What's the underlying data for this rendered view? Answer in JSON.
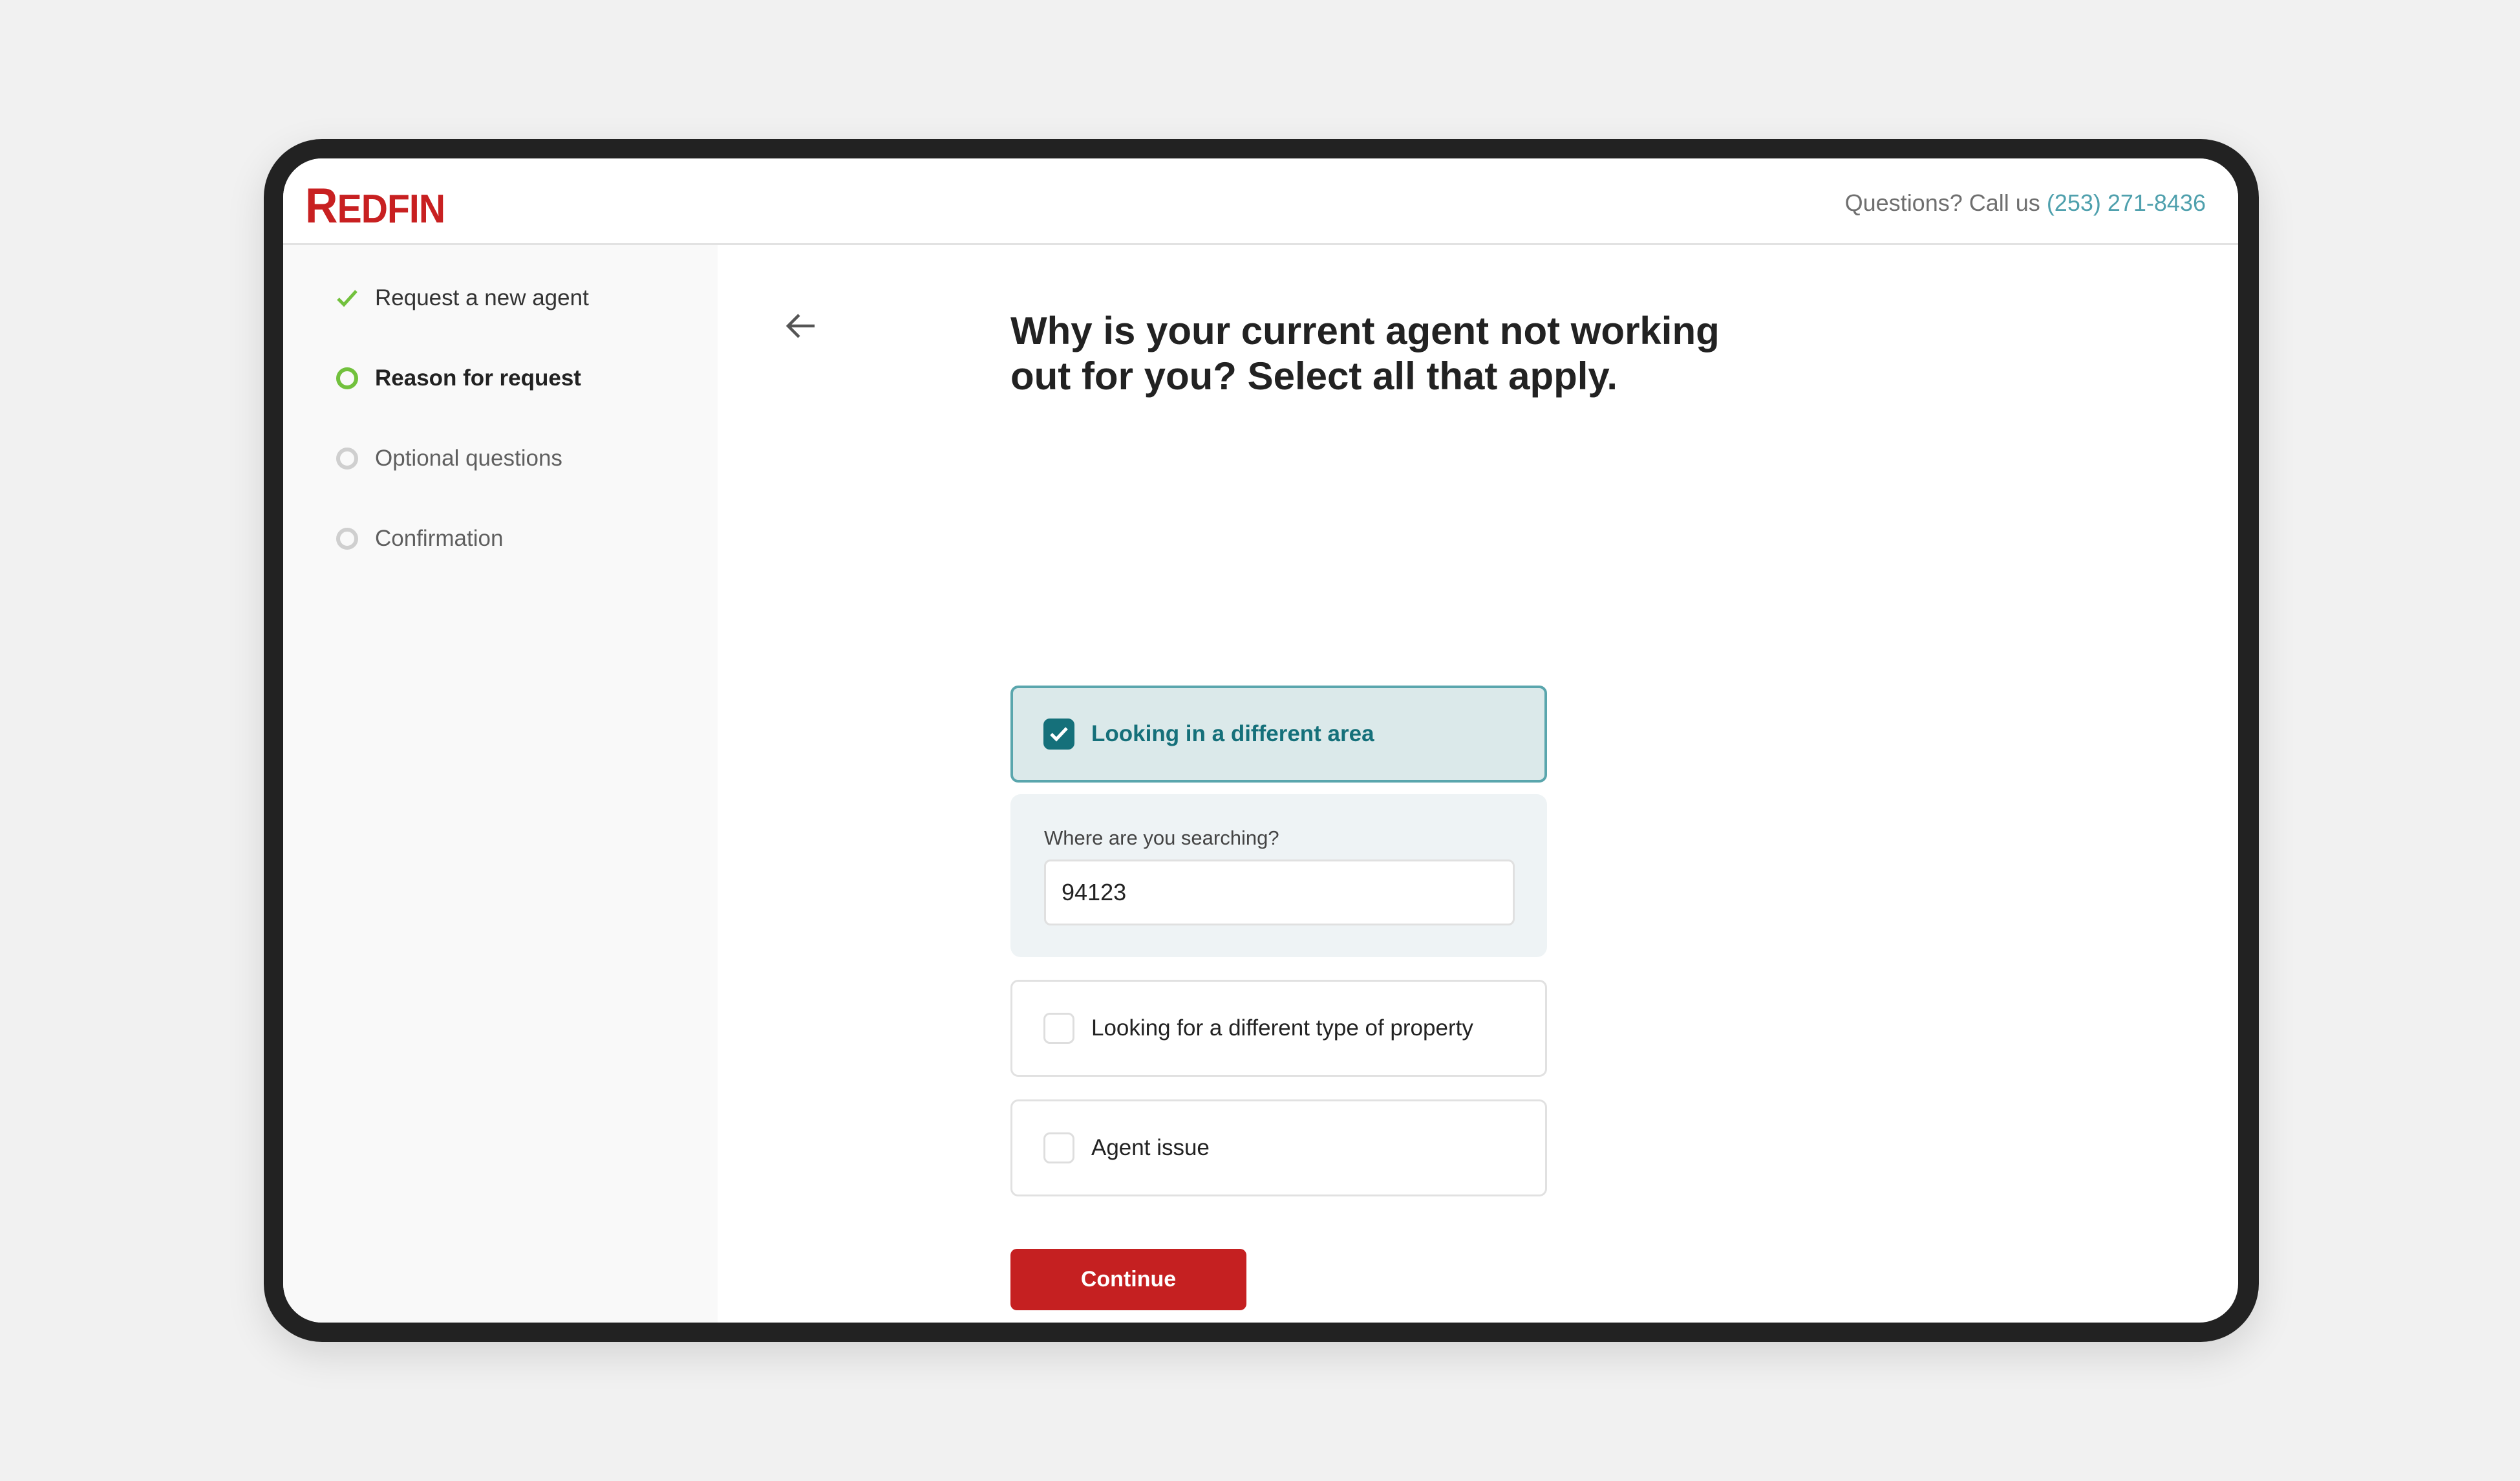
{
  "header": {
    "logo_text": "REDFIN",
    "help_prefix": "Questions? Call us",
    "phone": "(253) 271-8436"
  },
  "sidebar": {
    "steps": [
      {
        "label": "Request a new agent",
        "state": "complete",
        "icon": "checkmark-icon"
      },
      {
        "label": "Reason for request",
        "state": "active",
        "icon": "ring-icon"
      },
      {
        "label": "Optional questions",
        "state": "pending",
        "icon": "ring-icon"
      },
      {
        "label": "Confirmation",
        "state": "pending",
        "icon": "ring-icon"
      }
    ]
  },
  "main": {
    "back_icon": "arrow-left-icon",
    "title": "Why is your current agent not working out for you? Select all that apply.",
    "options": [
      {
        "label": "Looking in a different area",
        "checked": true
      },
      {
        "label": "Looking for a different type of property",
        "checked": false
      },
      {
        "label": "Agent issue",
        "checked": false
      }
    ],
    "location_field": {
      "label": "Where are you searching?",
      "value": "94123"
    },
    "continue_label": "Continue"
  },
  "colors": {
    "brand_red": "#c52021",
    "teal": "#15707a",
    "teal_border": "#5aa6ad",
    "link": "#4fa0ad",
    "step_green": "#72c13d"
  }
}
